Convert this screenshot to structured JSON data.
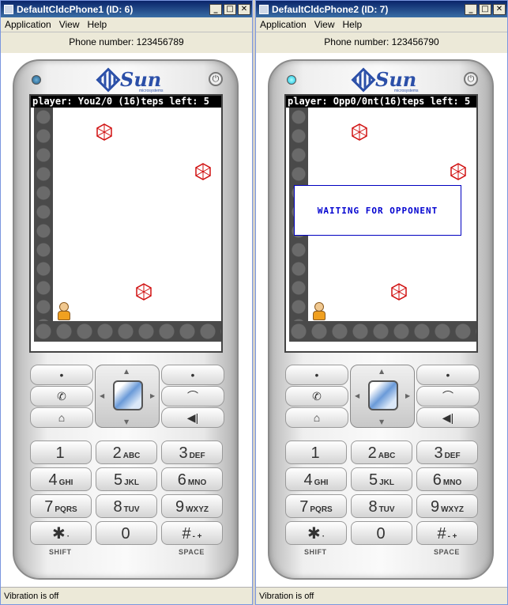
{
  "windows": [
    {
      "title": "DefaultCldcPhone1 (ID: 6)",
      "menu": [
        "Application",
        "View",
        "Help"
      ],
      "phone_number": "Phone number:  123456789",
      "hud": "player: You2/0 (16)teps left: 5",
      "waiting": "",
      "status": "Vibration is off"
    },
    {
      "title": "DefaultCldcPhone2 (ID: 7)",
      "menu": [
        "Application",
        "View",
        "Help"
      ],
      "phone_number": "Phone number:  123456790",
      "hud": "player: Opp0/0nt(16)teps left: 5",
      "waiting": "WAITING FOR OPPONENT",
      "status": "Vibration is off"
    }
  ],
  "window_buttons": {
    "minimize": "_",
    "maximize": "□",
    "close": "✕"
  },
  "brand": {
    "word": "Sun",
    "micro": "microsystems"
  },
  "keys": {
    "soft": [
      "•",
      "•"
    ],
    "call": "✆",
    "end": "⌒",
    "home": "⌂",
    "clear": "◀|",
    "numbers": [
      {
        "d": "1",
        "l": ""
      },
      {
        "d": "2",
        "l": "ABC"
      },
      {
        "d": "3",
        "l": "DEF"
      },
      {
        "d": "4",
        "l": "GHI"
      },
      {
        "d": "5",
        "l": "JKL"
      },
      {
        "d": "6",
        "l": "MNO"
      },
      {
        "d": "7",
        "l": "PQRS"
      },
      {
        "d": "8",
        "l": "TUV"
      },
      {
        "d": "9",
        "l": "WXYZ"
      },
      {
        "d": "✱",
        "l": "·"
      },
      {
        "d": "0",
        "l": ""
      },
      {
        "d": "#",
        "l": "- +"
      }
    ],
    "shift": "SHIFT",
    "space": "SPACE"
  },
  "colors": {
    "accent": "#0a246a",
    "waiting_text": "#0000d0",
    "screen_bg": "#000000"
  },
  "icons": [
    "power-icon",
    "dpad-up-icon",
    "dpad-down-icon",
    "dpad-left-icon",
    "dpad-right-icon",
    "rock-icon",
    "player-icon"
  ]
}
